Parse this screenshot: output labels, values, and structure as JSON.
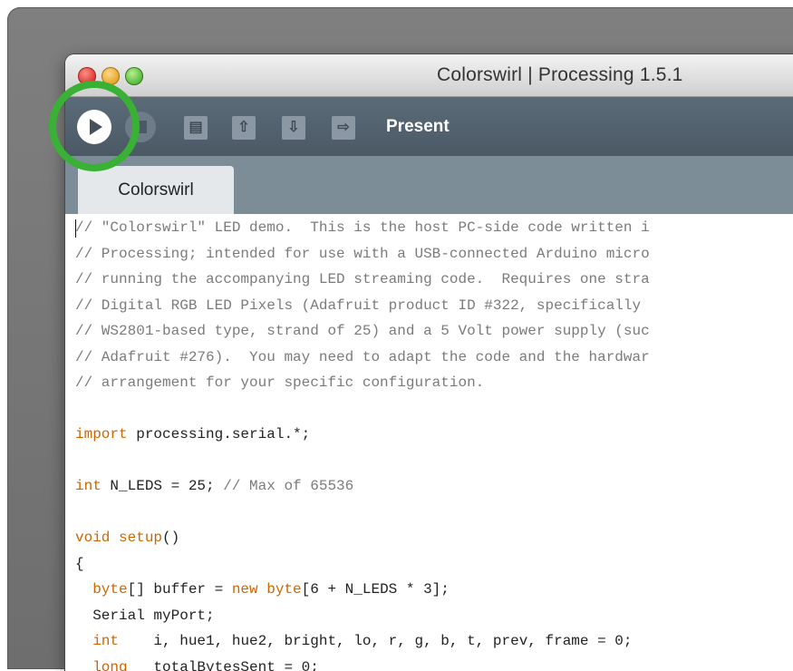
{
  "window": {
    "title": "Colorswirl | Processing 1.5.1"
  },
  "toolbar": {
    "run_icon": "play-icon",
    "stop_icon": "stop-icon",
    "buttons": [
      "new-file-icon",
      "open-upload-icon",
      "save-download-icon",
      "export-icon"
    ],
    "hover_label": "Present"
  },
  "tabs": [
    {
      "label": "Colorswirl",
      "active": true
    }
  ],
  "editor": {
    "lines": [
      {
        "parts": [
          {
            "t": "// \"Colorswirl\" LED demo.  This is the host PC-side code written i",
            "c": "comment"
          }
        ]
      },
      {
        "parts": [
          {
            "t": "// Processing; intended for use with a USB-connected Arduino micro",
            "c": "comment"
          }
        ]
      },
      {
        "parts": [
          {
            "t": "// running the accompanying LED streaming code.  Requires one stra",
            "c": "comment"
          }
        ]
      },
      {
        "parts": [
          {
            "t": "// Digital RGB LED Pixels (Adafruit product ID #322, specifically ",
            "c": "comment"
          }
        ]
      },
      {
        "parts": [
          {
            "t": "// WS2801-based type, strand of 25) and a 5 Volt power supply (suc",
            "c": "comment"
          }
        ]
      },
      {
        "parts": [
          {
            "t": "// Adafruit #276).  You may need to adapt the code and the hardwar",
            "c": "comment"
          }
        ]
      },
      {
        "parts": [
          {
            "t": "// arrangement for your specific configuration.",
            "c": "comment"
          }
        ]
      },
      {
        "parts": []
      },
      {
        "parts": [
          {
            "t": "import",
            "c": "kw"
          },
          {
            "t": " processing.serial.*;",
            "c": ""
          }
        ]
      },
      {
        "parts": []
      },
      {
        "parts": [
          {
            "t": "int",
            "c": "kw"
          },
          {
            "t": " N_LEDS = 25; ",
            "c": ""
          },
          {
            "t": "// Max of 65536",
            "c": "comment"
          }
        ]
      },
      {
        "parts": []
      },
      {
        "parts": [
          {
            "t": "void",
            "c": "kw"
          },
          {
            "t": " ",
            "c": ""
          },
          {
            "t": "setup",
            "c": "kw"
          },
          {
            "t": "()",
            "c": ""
          }
        ]
      },
      {
        "parts": [
          {
            "t": "{",
            "c": ""
          }
        ]
      },
      {
        "parts": [
          {
            "t": "  ",
            "c": ""
          },
          {
            "t": "byte",
            "c": "kw"
          },
          {
            "t": "[] buffer = ",
            "c": ""
          },
          {
            "t": "new",
            "c": "kw"
          },
          {
            "t": " ",
            "c": ""
          },
          {
            "t": "byte",
            "c": "kw"
          },
          {
            "t": "[6 + N_LEDS * 3];",
            "c": ""
          }
        ]
      },
      {
        "parts": [
          {
            "t": "  Serial myPort;",
            "c": ""
          }
        ]
      },
      {
        "parts": [
          {
            "t": "  ",
            "c": ""
          },
          {
            "t": "int",
            "c": "kw"
          },
          {
            "t": "    i, hue1, hue2, bright, lo, r, g, b, t, prev, frame = 0;",
            "c": ""
          }
        ]
      },
      {
        "parts": [
          {
            "t": "  ",
            "c": ""
          },
          {
            "t": "long",
            "c": "kw"
          },
          {
            "t": "   totalBytesSent = 0;",
            "c": ""
          }
        ]
      }
    ]
  }
}
